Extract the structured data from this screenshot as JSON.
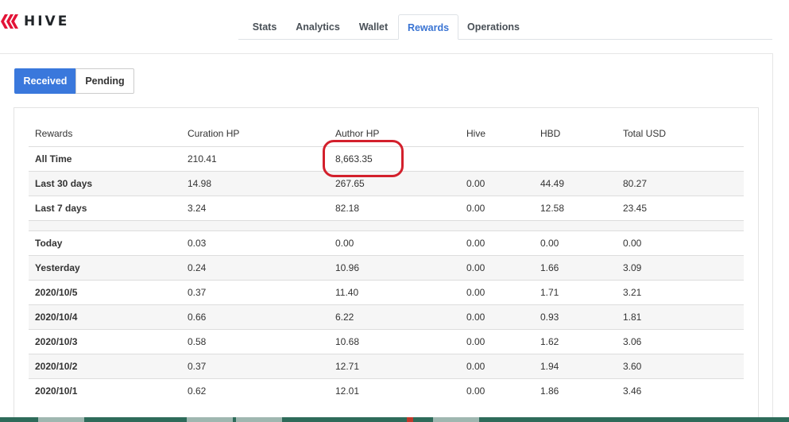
{
  "brand": {
    "name": "HIVE",
    "logo_icon": "hive-logo-icon",
    "color": "#e31337"
  },
  "tabs": [
    {
      "label": "Stats",
      "active": false
    },
    {
      "label": "Analytics",
      "active": false
    },
    {
      "label": "Wallet",
      "active": false
    },
    {
      "label": "Rewards",
      "active": true
    },
    {
      "label": "Operations",
      "active": false
    }
  ],
  "toggle": {
    "received": "Received",
    "pending": "Pending",
    "selected": "Received"
  },
  "table": {
    "headers": [
      "Rewards",
      "Curation HP",
      "Author HP",
      "Hive",
      "HBD",
      "Total USD"
    ],
    "summary_rows": [
      {
        "label": "All Time",
        "curation": "210.41",
        "author": "8,663.35",
        "hive": "",
        "hbd": "",
        "usd": ""
      },
      {
        "label": "Last 30 days",
        "curation": "14.98",
        "author": "267.65",
        "hive": "0.00",
        "hbd": "44.49",
        "usd": "80.27"
      },
      {
        "label": "Last 7 days",
        "curation": "3.24",
        "author": "82.18",
        "hive": "0.00",
        "hbd": "12.58",
        "usd": "23.45"
      }
    ],
    "daily_rows": [
      {
        "label": "Today",
        "curation": "0.03",
        "author": "0.00",
        "hive": "0.00",
        "hbd": "0.00",
        "usd": "0.00"
      },
      {
        "label": "Yesterday",
        "curation": "0.24",
        "author": "10.96",
        "hive": "0.00",
        "hbd": "1.66",
        "usd": "3.09"
      },
      {
        "label": "2020/10/5",
        "curation": "0.37",
        "author": "11.40",
        "hive": "0.00",
        "hbd": "1.71",
        "usd": "3.21"
      },
      {
        "label": "2020/10/4",
        "curation": "0.66",
        "author": "6.22",
        "hive": "0.00",
        "hbd": "0.93",
        "usd": "1.81"
      },
      {
        "label": "2020/10/3",
        "curation": "0.58",
        "author": "10.68",
        "hive": "0.00",
        "hbd": "1.62",
        "usd": "3.06"
      },
      {
        "label": "2020/10/2",
        "curation": "0.37",
        "author": "12.71",
        "hive": "0.00",
        "hbd": "1.94",
        "usd": "3.60"
      },
      {
        "label": "2020/10/1",
        "curation": "0.62",
        "author": "12.01",
        "hive": "0.00",
        "hbd": "1.86",
        "usd": "3.46"
      }
    ]
  },
  "colors": {
    "accent": "#3a78dc",
    "highlight": "#d3202c"
  }
}
